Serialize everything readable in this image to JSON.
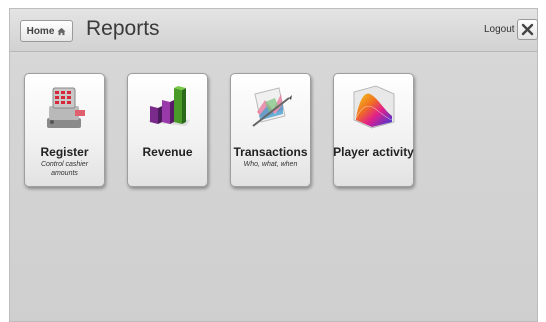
{
  "header": {
    "home_label": "Home",
    "title": "Reports",
    "logout_label": "Logout"
  },
  "tiles": [
    {
      "label": "Register",
      "sub": "Control cashier amounts",
      "icon": "cash-register-icon"
    },
    {
      "label": "Revenue",
      "sub": "",
      "icon": "bar-chart-icon"
    },
    {
      "label": "Transactions",
      "sub": "Who, what, when",
      "icon": "transactions-icon"
    },
    {
      "label": "Player activity",
      "sub": "",
      "icon": "surface-chart-icon"
    }
  ]
}
